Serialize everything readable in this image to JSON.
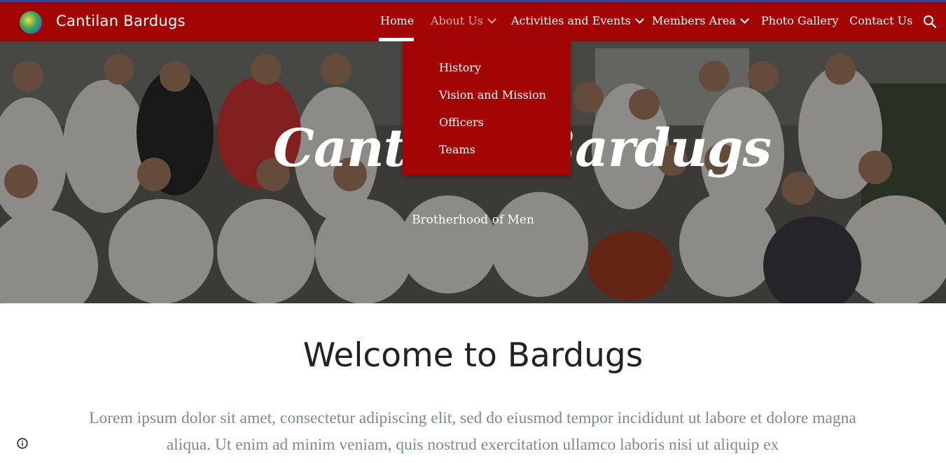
{
  "header": {
    "site_title": "Cantilan Bardugs",
    "accent_color": "#a30505",
    "logo_icon": "circle-logo-icon",
    "search_icon": "search-icon"
  },
  "nav": {
    "items": [
      {
        "label": "Home",
        "active": true
      },
      {
        "label": "About Us",
        "has_dropdown": true,
        "open": true
      },
      {
        "label": "Activities and Events",
        "has_dropdown": true
      },
      {
        "label": "Members Area",
        "has_dropdown": true
      },
      {
        "label": "Photo Gallery"
      },
      {
        "label": "Contact Us"
      }
    ]
  },
  "dropdown": {
    "items": [
      "History",
      "Vision and Mission",
      "Officers",
      "Teams"
    ]
  },
  "hero": {
    "title": "Cantilan Bardugs",
    "subtitle": "Brotherhood of Men"
  },
  "main": {
    "heading": "Welcome to Bardugs",
    "body": "Lorem ipsum dolor sit amet, consectetur adipiscing elit, sed do eiusmod tempor incididunt ut labore et dolore magna aliqua. Ut enim ad minim veniam, quis nostrud exercitation ullamco laboris nisi ut aliquip ex"
  },
  "footer": {
    "info_icon": "info-icon"
  }
}
